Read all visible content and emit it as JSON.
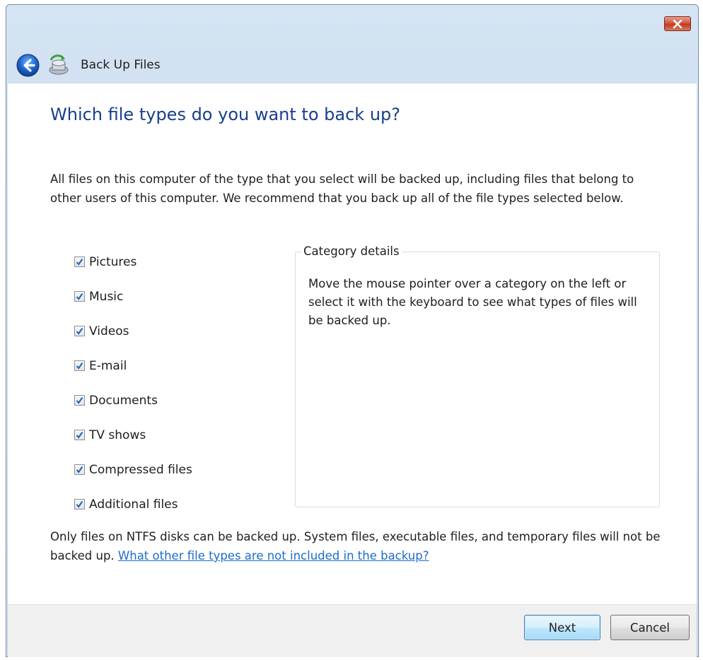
{
  "window": {
    "title": "Back Up Files",
    "close_icon": "close-icon",
    "back_icon": "back-arrow-icon",
    "app_icon": "backup-icon"
  },
  "main": {
    "heading": "Which file types do you want to back up?",
    "intro": "All files on this computer of the type that you select will be backed up, including files that belong to other users of this computer. We recommend that you back up all of the file types selected below."
  },
  "categories": [
    {
      "label": "Pictures",
      "checked": true
    },
    {
      "label": "Music",
      "checked": true
    },
    {
      "label": "Videos",
      "checked": true
    },
    {
      "label": "E-mail",
      "checked": true
    },
    {
      "label": "Documents",
      "checked": true
    },
    {
      "label": "TV shows",
      "checked": true
    },
    {
      "label": "Compressed files",
      "checked": true
    },
    {
      "label": "Additional files",
      "checked": true
    }
  ],
  "details": {
    "legend": "Category details",
    "text": "Move the mouse pointer over a category on the left or select it with the keyboard to see what types of files will be backed up."
  },
  "footer": {
    "note": "Only files on NTFS disks can be backed up. System files, executable files, and temporary files will not be backed up.",
    "link": "What other file types are not included in the backup?"
  },
  "buttons": {
    "next": "Next",
    "cancel": "Cancel"
  },
  "colors": {
    "heading": "#1a3e8c",
    "link": "#1c6cc8",
    "close_button": "#c23a22"
  }
}
